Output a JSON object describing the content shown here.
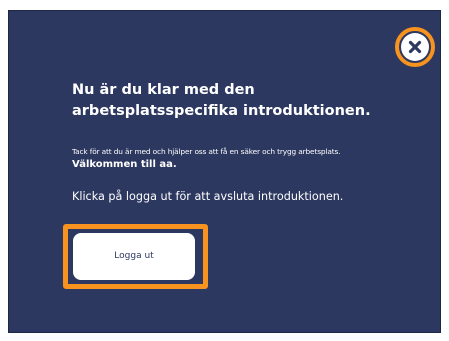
{
  "dialog": {
    "close_icon": "close-icon",
    "heading": "Nu är du klar med den arbetsplatsspecifika introduktionen.",
    "thanks_text": "Tack för att du är med och hjälper oss att få en säker och trygg arbetsplats.",
    "welcome_text": "Välkommen till aa.",
    "instruction": "Klicka på logga ut för att avsluta introduktionen.",
    "logout_label": "Logga ut"
  },
  "colors": {
    "dialog_background": "#2d3860",
    "highlight": "#f7931e",
    "button_background": "#ffffff",
    "text": "#ffffff"
  }
}
